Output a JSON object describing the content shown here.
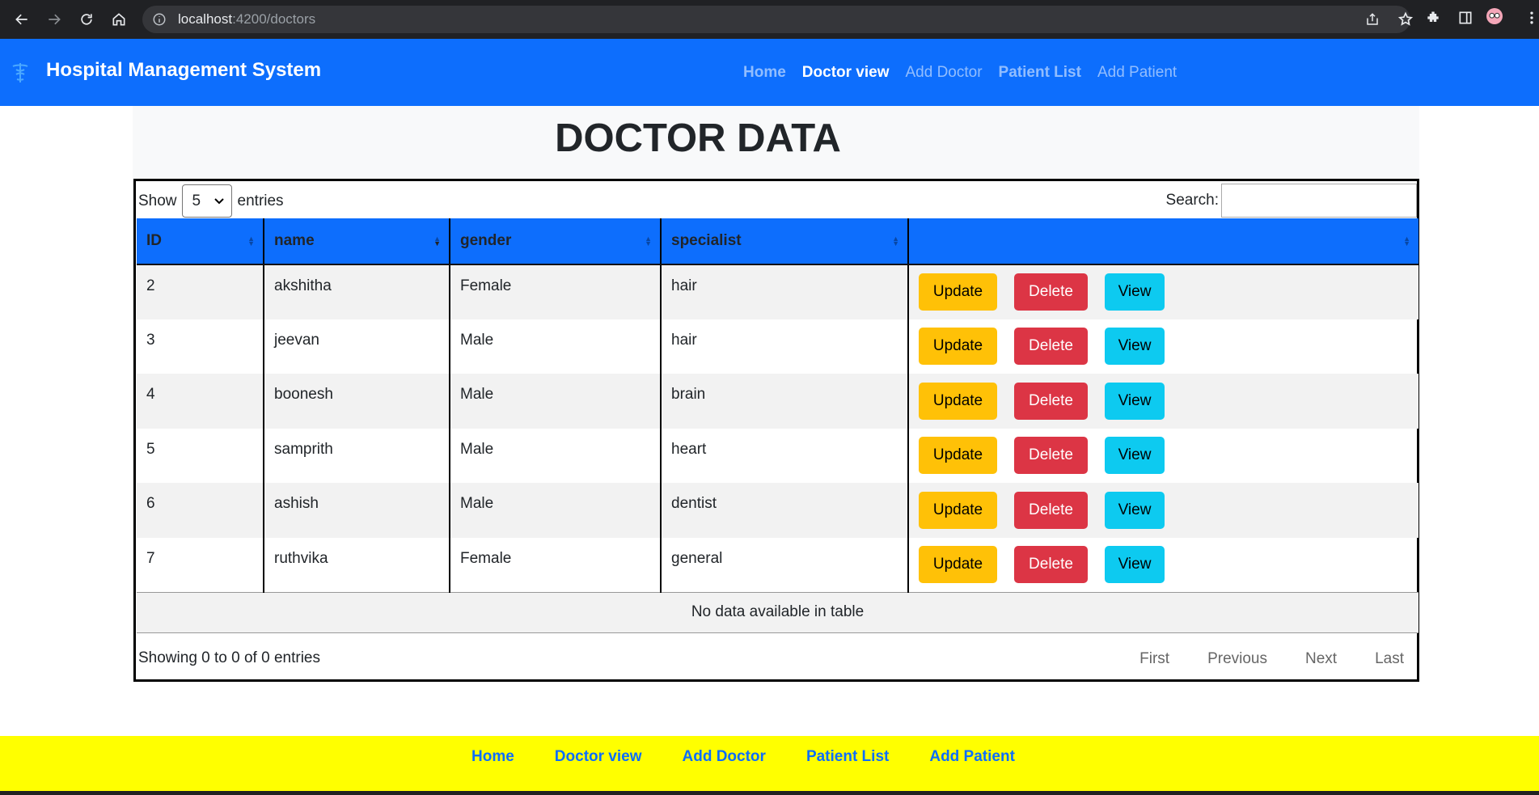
{
  "browser": {
    "url_host": "localhost",
    "url_path": ":4200/doctors"
  },
  "navbar": {
    "brand": "Hospital Management System",
    "links": [
      "Home",
      "Doctor view",
      "Add Doctor",
      "Patient List",
      "Add Patient"
    ],
    "active": "Doctor view"
  },
  "page": {
    "title": "DOCTOR DATA"
  },
  "table_controls": {
    "show_label": "Show",
    "entries_label": "entries",
    "length_value": "5",
    "search_label": "Search:",
    "search_value": ""
  },
  "table": {
    "columns": [
      "ID",
      "name",
      "gender",
      "specialist",
      ""
    ],
    "rows": [
      {
        "id": "2",
        "name": "akshitha",
        "gender": "Female",
        "specialist": "hair"
      },
      {
        "id": "3",
        "name": "jeevan",
        "gender": "Male",
        "specialist": "hair"
      },
      {
        "id": "4",
        "name": "boonesh",
        "gender": "Male",
        "specialist": "brain"
      },
      {
        "id": "5",
        "name": "samprith",
        "gender": "Male",
        "specialist": "heart"
      },
      {
        "id": "6",
        "name": "ashish",
        "gender": "Male",
        "specialist": "dentist"
      },
      {
        "id": "7",
        "name": "ruthvika",
        "gender": "Female",
        "specialist": "general"
      }
    ],
    "actions": {
      "update": "Update",
      "delete": "Delete",
      "view": "View"
    },
    "empty_message": "No data available in table"
  },
  "footer_info": {
    "showing": "Showing 0 to 0 of 0 entries",
    "pagination": [
      "First",
      "Previous",
      "Next",
      "Last"
    ]
  },
  "footer": {
    "links": [
      "Home",
      "Doctor view",
      "Add Doctor",
      "Patient List",
      "Add Patient"
    ]
  },
  "colors": {
    "navbar": "#0d6efd",
    "footer": "#ffff00",
    "update": "#ffc107",
    "delete": "#dc3545",
    "view": "#0dcaf0"
  }
}
